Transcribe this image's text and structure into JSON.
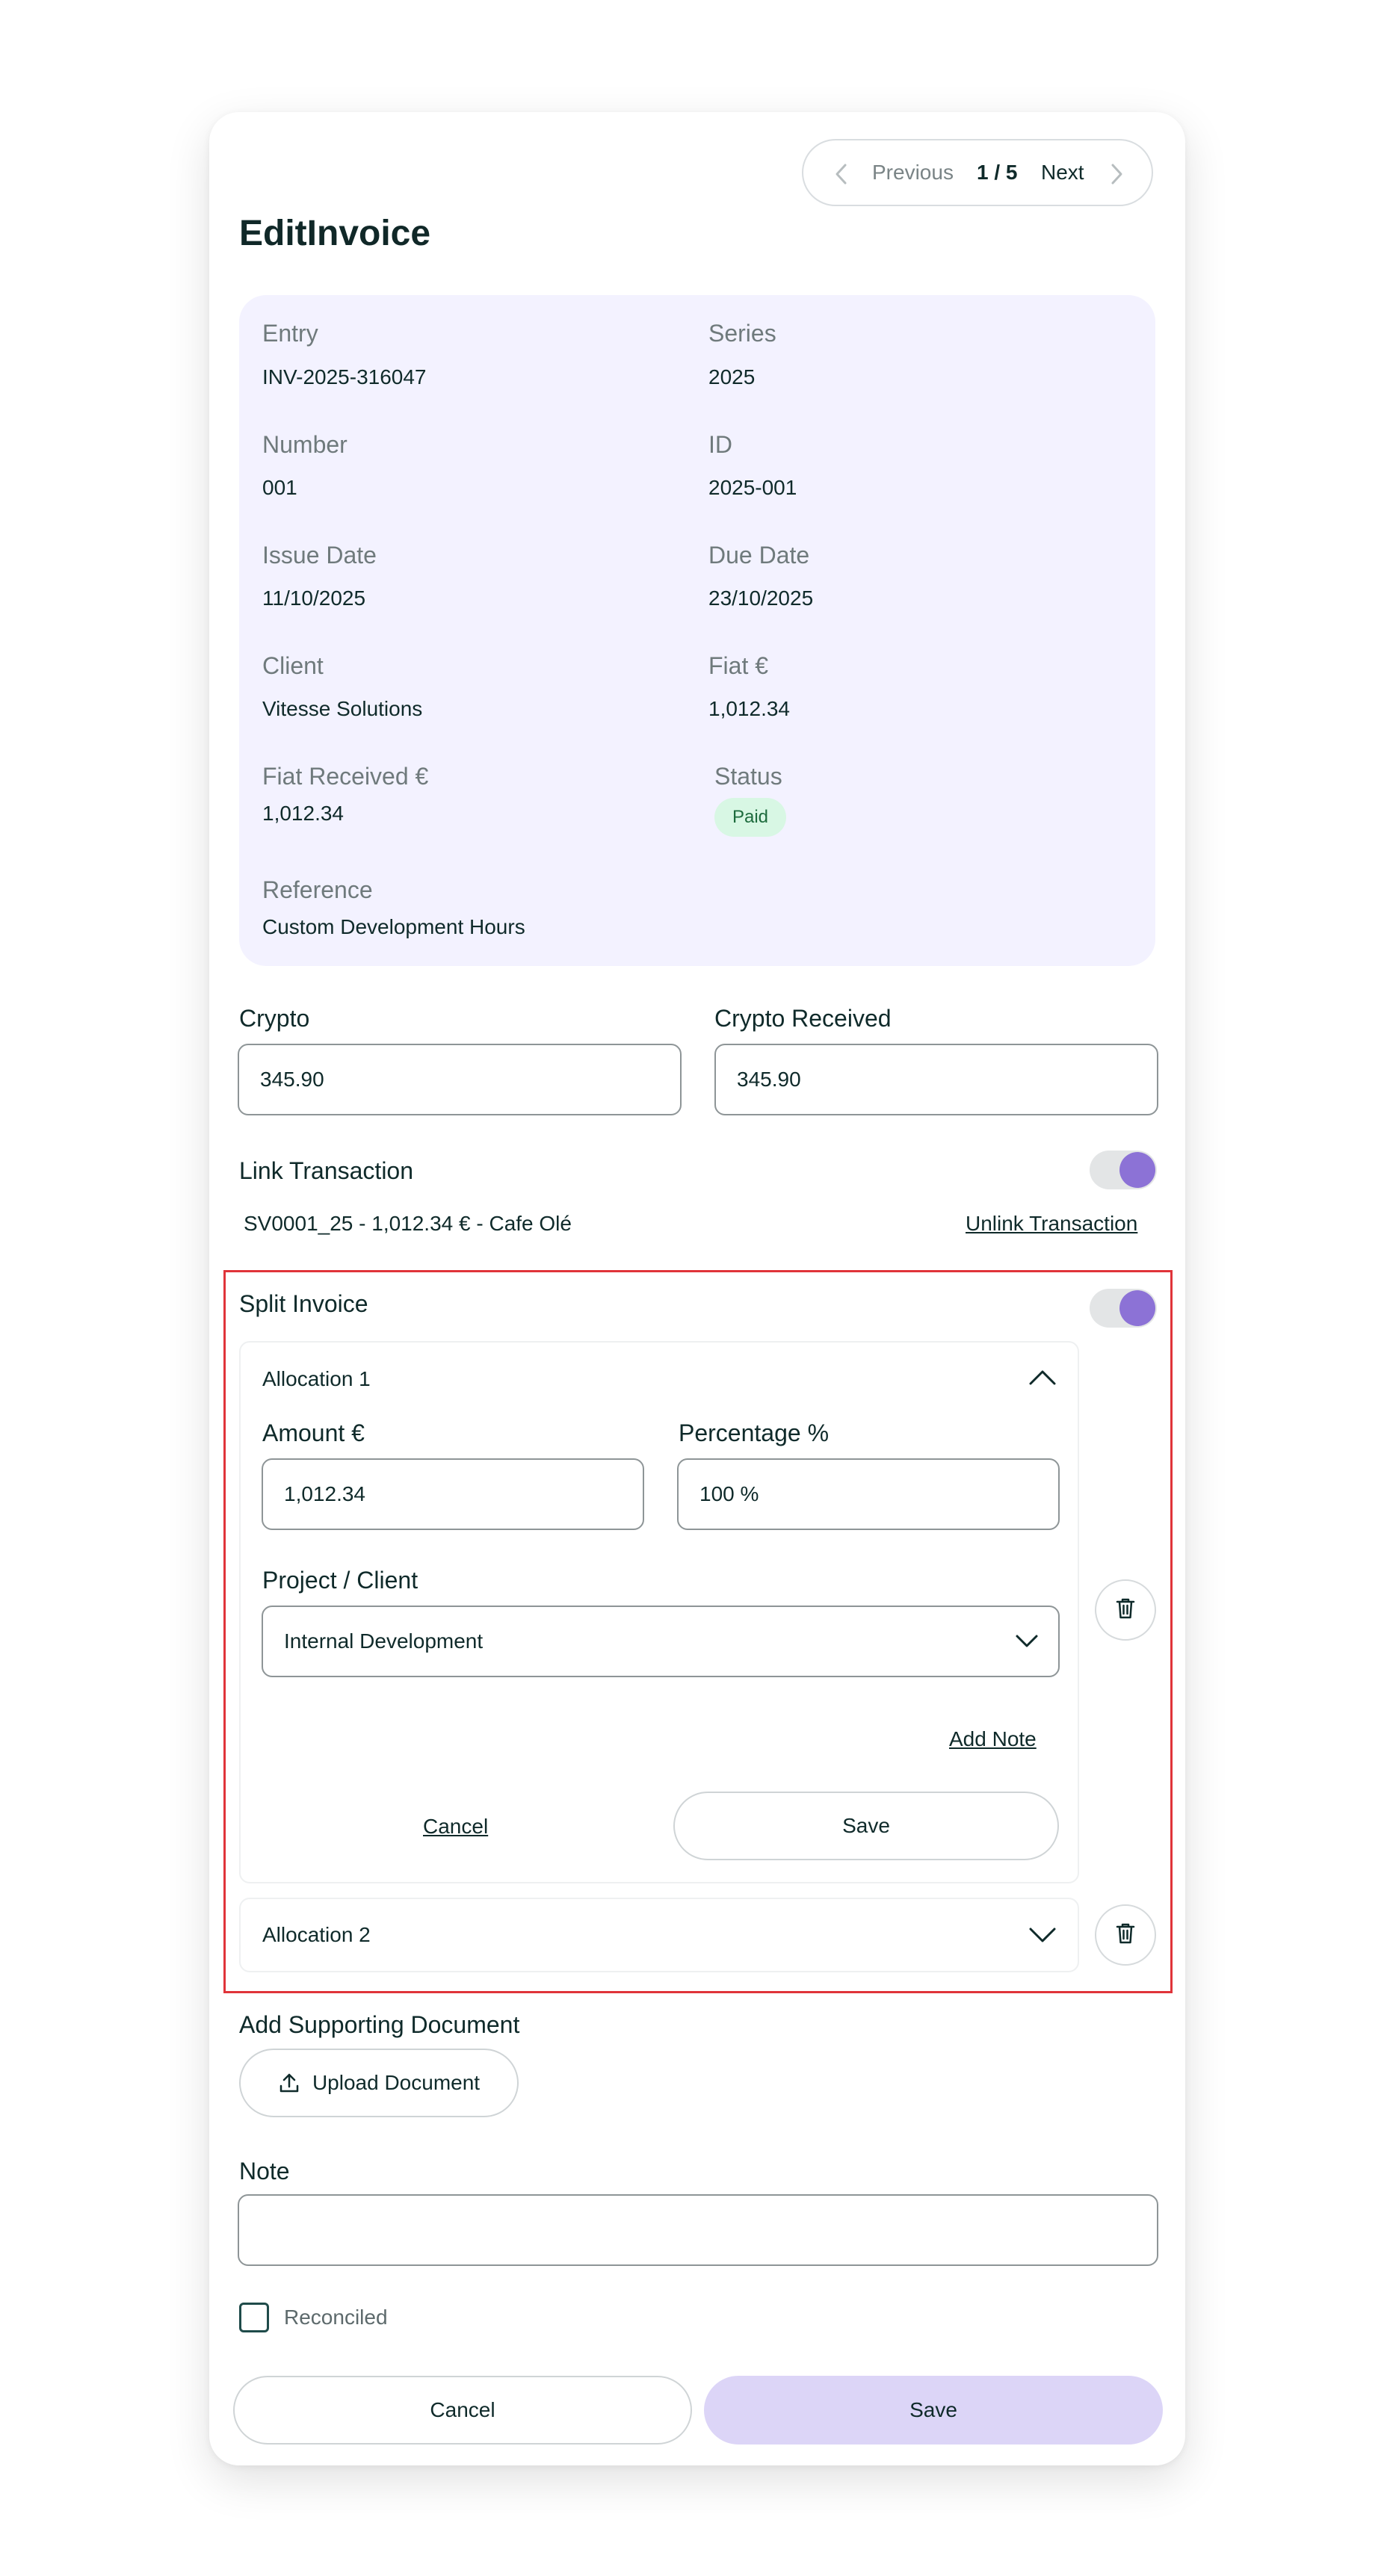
{
  "pager": {
    "prev_label": "Previous",
    "counter": "1 / 5",
    "next_label": "Next"
  },
  "title": "EditInvoice",
  "summary": {
    "entry_label": "Entry",
    "entry_value": "INV-2025-316047",
    "series_label": "Series",
    "series_value": "2025",
    "number_label": "Number",
    "number_value": "001",
    "id_label": "ID",
    "id_value": "2025-001",
    "issue_label": "Issue Date",
    "issue_value": "11/10/2025",
    "due_label": "Due Date",
    "due_value": "23/10/2025",
    "client_label": "Client",
    "client_value": "Vitesse Solutions",
    "fiat_label": "Fiat €",
    "fiat_value": "1,012.34",
    "fiat_received_label": "Fiat Received €",
    "fiat_received_value": "1,012.34",
    "status_label": "Status",
    "status_value": "Paid",
    "reference_label": "Reference",
    "reference_value": "Custom Development Hours"
  },
  "crypto": {
    "label": "Crypto",
    "value": "345.90"
  },
  "crypto_received": {
    "label": "Crypto Received",
    "value": "345.90"
  },
  "link_transaction": {
    "label": "Link Transaction",
    "linked": "SV0001_25 - 1,012.34 € - Cafe Olé",
    "unlink_label": "Unlink Transaction",
    "enabled": true
  },
  "split_invoice": {
    "label": "Split Invoice",
    "enabled": true,
    "allocation1": {
      "title": "Allocation 1",
      "amount_label": "Amount €",
      "amount_value": "1,012.34",
      "percentage_label": "Percentage %",
      "percentage_value": "100 %",
      "project_label": "Project / Client",
      "project_value": "Internal Development",
      "add_note_label": "Add Note",
      "cancel_label": "Cancel",
      "save_label": "Save"
    },
    "allocation2": {
      "title": "Allocation 2"
    }
  },
  "supporting_doc": {
    "label": "Add Supporting Document",
    "upload_label": "Upload Document"
  },
  "note": {
    "label": "Note",
    "value": ""
  },
  "reconciled": {
    "label": "Reconciled",
    "checked": false
  },
  "footer": {
    "cancel_label": "Cancel",
    "save_label": "Save"
  },
  "colors": {
    "accent": "#8c72d6",
    "summary_bg": "#f3f2ff",
    "save_bg": "#dcd5f7",
    "paid_bg": "#d8f7e4",
    "highlight": "#e0343a"
  }
}
